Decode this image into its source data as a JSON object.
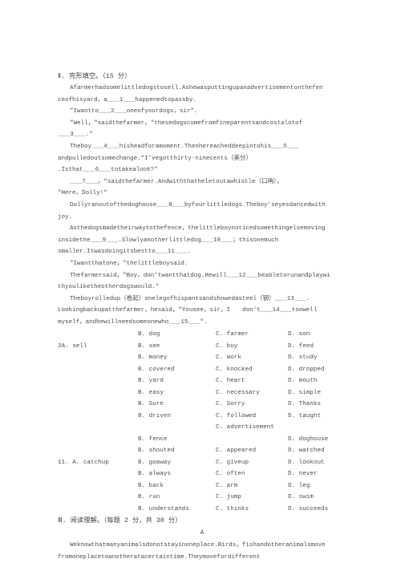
{
  "document": {
    "type": "scanned-exam-paper",
    "language": "zh-CN + en"
  },
  "section_cloze": {
    "heading": "Ⅱ. 完形填空。（15 分）",
    "paragraphs": [
      {
        "indent": true,
        "lines": [
          "Afarmerhadsomelittledogstosell.Ashewasputtingupanadvertisementonthefen",
          "ceofhisyard，a＿＿1＿＿happenedtopassby."
        ]
      },
      {
        "indent": true,
        "lines": [
          "\"Iwantto＿＿2＿＿oneofyourdogs，sir\"."
        ]
      },
      {
        "indent": true,
        "lines": [
          "\"Well，\"saidthefarmer，\"thesedogscomefromfineparentsandcostalotof",
          "＿＿3＿＿.\""
        ]
      },
      {
        "indent": true,
        "lines": [
          "Theboy＿＿4＿＿hisheadforamoment.Thenhereacheddeepintohis＿＿5＿＿",
          "andpulledoutsomechange.\"I'vegotthirty-ninecents（美分）",
          ".Isthat＿＿6＿＿totakealook?\""
        ]
      },
      {
        "indent": true,
        "lines": [
          "＿＿7＿＿，\"saidthefarmer.Andwiththatheletoutawhistle（口哨），",
          "\"Here，Dolly!\""
        ]
      },
      {
        "indent": true,
        "lines": [
          "Dollyranoutofthedoghouse＿＿8＿＿byfourlittledogs.Theboy'seyesdancedwith",
          "joy."
        ]
      },
      {
        "indent": true,
        "lines": [
          "Asthedogsmadetheirwaytothefence，thelittleboynoticedsomethingelsemoving",
          "insidethe＿＿9＿＿.Slowlyanotherlittledog＿＿10＿＿；thisonemuch",
          "smaller.Itwasdoingitsbestto＿＿11＿＿."
        ]
      },
      {
        "indent": true,
        "lines": [
          "\"Iwantthatone，\"thelittleboysaid."
        ]
      },
      {
        "indent": true,
        "lines": [
          "Thefarmersaid，\"Boy，don'twantthatdog.Hewill＿＿12＿＿beabletorunandplaywi",
          "thyouliketheotherdogswould.\""
        ]
      },
      {
        "indent": true,
        "lines": [
          "Theboyrolledup（卷起）onelegofhispantsandshowedasteel（钢）＿＿13＿＿.",
          "Lookingbackupatthefarmer，hesaid，\"Yousee，sir，I　　don't＿＿14＿＿toowell",
          "myself，andhewillneedsomeonewho＿＿15＿＿\"."
        ]
      }
    ]
  },
  "options": {
    "rows": [
      {
        "a": "",
        "b": "B. dog",
        "c": "C. farmer",
        "d": "D. son"
      },
      {
        "a": "2A. sell",
        "b": "B. see",
        "c": "C. buy",
        "d": "D. feed"
      },
      {
        "a": "",
        "b": "B. money",
        "c": "C. work",
        "d": "D. study"
      },
      {
        "a": "",
        "b": "B. covered",
        "c": "C. knocked",
        "d": "D. dropped"
      },
      {
        "a": "",
        "b": "B. yard",
        "c": "C. heart",
        "d": "D. mouth"
      },
      {
        "a": "",
        "b": "B. easy",
        "c": "C. necessary",
        "d": "D. simple"
      },
      {
        "a": "",
        "b": "B. Sure",
        "c": "C. Sorry",
        "d": "D. Thanks"
      },
      {
        "a": "",
        "b": "B. driven",
        "c": "C. followed",
        "d": "D. taught"
      },
      {
        "a": "",
        "b": "",
        "c": "C. advertisement",
        "d": ""
      },
      {
        "a": "",
        "b": "B. fence",
        "c": "",
        "d": "D. doghouse"
      },
      {
        "a": "",
        "b": "B. shouted",
        "c": "C. appeared",
        "d": "D. watched"
      },
      {
        "a": "11. A. catchup",
        "b": "B. goaway",
        "c": "C. giveup",
        "d": "D. lookout"
      },
      {
        "a": "",
        "b": "B. always",
        "c": "C. often",
        "d": "D. never"
      },
      {
        "a": "",
        "b": "B. back",
        "c": "C. arm",
        "d": "D. leg"
      },
      {
        "a": "",
        "b": "B. run",
        "c": "C. jump",
        "d": "D. swim"
      },
      {
        "a": "",
        "b": "B. understands",
        "c": "C. thinks",
        "d": "D. succeeds"
      }
    ]
  },
  "section_reading": {
    "heading": "Ⅲ. 阅读理解。（每题 2 分，共 30 分）",
    "passage_label": "A",
    "paragraphs": [
      {
        "indent": true,
        "lines": [
          "Weknowthatmanyanimalsdonotstayinoneplace.Birds，fishandotheranimalsmove",
          "fromoneplacetoanotheratacertaintime.Theymovefordifferent"
        ]
      }
    ]
  }
}
